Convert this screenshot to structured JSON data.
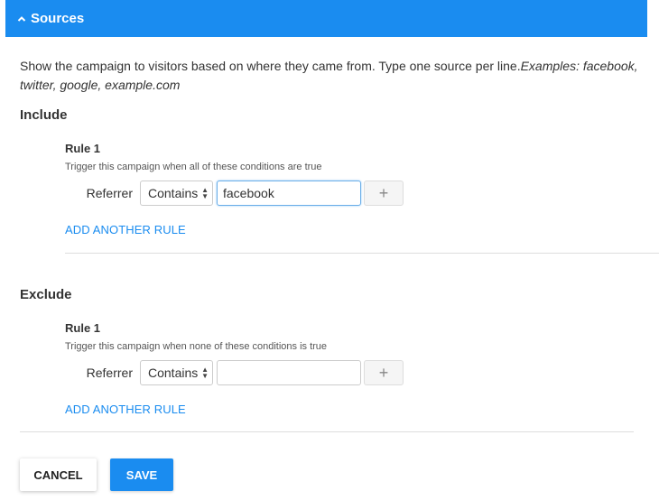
{
  "header": {
    "title": "Sources",
    "icon": "chevron-up-icon",
    "color": "#1a8cf0"
  },
  "description": {
    "text": "Show the campaign to visitors based on where they came from. Type one source per line.",
    "examples": "Examples: facebook, twitter, google, example.com"
  },
  "include": {
    "title": "Include",
    "rule": {
      "title": "Rule 1",
      "subtitle": "Trigger this campaign when all of these conditions are true",
      "field": "Referrer",
      "operator": "Contains",
      "value": "facebook",
      "add_label": "+"
    },
    "add_rule": "ADD ANOTHER RULE"
  },
  "exclude": {
    "title": "Exclude",
    "rule": {
      "title": "Rule 1",
      "subtitle": "Trigger this campaign when none of these conditions is true",
      "field": "Referrer",
      "operator": "Contains",
      "value": "",
      "add_label": "+"
    },
    "add_rule": "ADD ANOTHER RULE"
  },
  "actions": {
    "cancel": "CANCEL",
    "save": "SAVE"
  }
}
